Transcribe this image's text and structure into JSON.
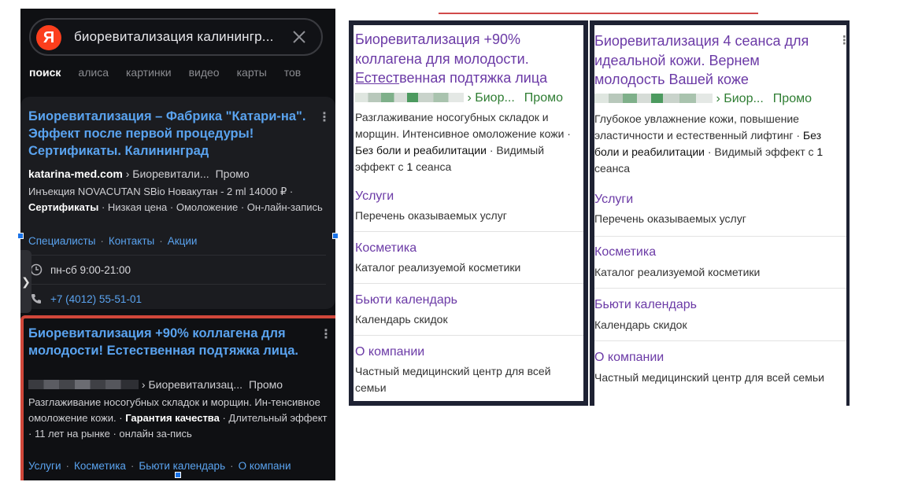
{
  "left_phone": {
    "logo_letter": "Я",
    "search_query": "биоревитализация калинингр...",
    "tabs": [
      {
        "label": "поиск",
        "active": true
      },
      {
        "label": "алиса",
        "active": false
      },
      {
        "label": "картинки",
        "active": false
      },
      {
        "label": "видео",
        "active": false
      },
      {
        "label": "карты",
        "active": false
      },
      {
        "label": "тов",
        "active": false
      }
    ],
    "result1": {
      "title": "Биоревитализация – Фабрика \"Катари-на\". Эффект после первой процедуры! Сертификаты. Калининград",
      "domain": "katarina-med.com",
      "path": " › Биоревитали...",
      "promo": "Промо",
      "desc_1": "Инъекция NOVACUTAN SBio Новакутан - 2 ml 14000 ₽ · ",
      "desc_bold": "Сертификаты",
      "desc_2": " · Низкая цена · Омоложение · Он-лайн-запись",
      "sitelinks": [
        "Специалисты",
        "Контакты",
        "Акции"
      ],
      "hours": "пн-сб 9:00-21:00",
      "phone": "+7 (4012) 55-51-01"
    },
    "result2": {
      "title": "Биоревитализация +90% коллагена для молодости! Естественная подтяжка лица.",
      "path": " › Биоревитализац...",
      "promo": "Промо",
      "desc_1": "Разглаживание носогубных складок и морщин. Ин-тенсивное омоложение кожи. · ",
      "desc_bold": "Гарантия качества",
      "desc_2": " · Длительный эффект · 11 лет на рынке · онлайн за-пись",
      "sitelinks": [
        "Услуги",
        "Косметика",
        "Бьюти календарь",
        "О компани"
      ]
    }
  },
  "ad_variant_a": {
    "title_1": "Биоревитализация +90% коллагена для молодости. ",
    "title_2": "Естест",
    "title_2u": "венная",
    "title_3": " подтяжка лица",
    "path": "› Биор...",
    "promo": "Промо",
    "desc_1": "Разглаживание носогубных складок и морщин. Интенсивное омоложение кожи · ",
    "desc_bold": "Без боли и реабилитации",
    "desc_2": " · Видимый эффект с ",
    "desc_num": "1",
    "desc_3": " сеанса",
    "sitelinks": [
      {
        "title": "Услуги",
        "desc": "Перечень оказываемых услуг"
      },
      {
        "title": "Косметика",
        "desc": "Каталог реализуемой косметики"
      },
      {
        "title": "Бьюти календарь",
        "desc": "Календарь скидок"
      },
      {
        "title": "О компании",
        "desc": "Частный медицинский центр для всей семьи"
      }
    ]
  },
  "ad_variant_b": {
    "title": "Биоревитализация 4 сеанса для идеальной кожи. Вернем молодость Вашей коже",
    "path": "› Биор...",
    "promo": "Промо",
    "desc_1": "Глубокое увлажнение кожи, повышение эластичности и естественный лифтинг · ",
    "desc_bold": "Без боли и реабилитации",
    "desc_2": " · Видимый эффект с ",
    "desc_num": "1",
    "desc_3": " сеанса",
    "sitelinks": [
      {
        "title": "Услуги",
        "desc": "Перечень оказываемых услуг"
      },
      {
        "title": "Косметика",
        "desc": "Каталог реализуемой косметики"
      },
      {
        "title": "Бьюти календарь",
        "desc": "Календарь скидок"
      },
      {
        "title": "О компании",
        "desc": "Частный медицинский центр для всей семьи"
      }
    ]
  },
  "colors": {
    "dark_bg": "#0f1013",
    "dark_link": "#5aa3ef",
    "highlight_border": "#d0473a",
    "light_title": "#6b3aa6",
    "promo_green": "#2e7d32"
  }
}
